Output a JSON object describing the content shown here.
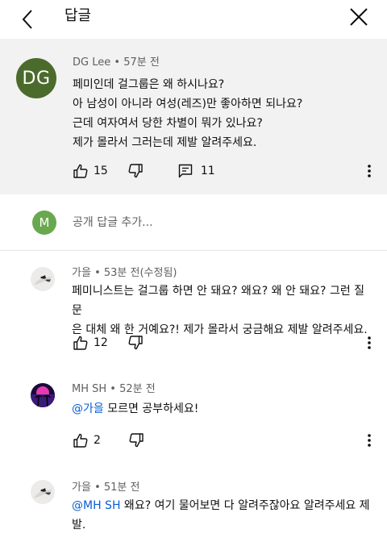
{
  "header": {
    "title": "답글"
  },
  "comment": {
    "avatar_initials": "DG",
    "author": "DG Lee",
    "time": "57분 전",
    "lines": [
      "페미인데 걸그룹은 왜 하시나요?",
      "아 남성이 아니라 여성(레즈)만 좋아하면 되나요?",
      "근데 여자여서 당한 차별이 뭐가 있나요?",
      "제가 몰라서 그러는데 제발 알려주세요."
    ],
    "likes": "15",
    "reply_count": "11"
  },
  "reply_input": {
    "avatar_initial": "M",
    "placeholder": "공개 답글 추가..."
  },
  "replies": [
    {
      "author": "가을",
      "time": "53분 전(수정됨)",
      "lines": [
        "페미니스트는 걸그룹 하면 안 돼요? 왜요? 왜 안 돼요? 그런 질문",
        "은 대체 왜 한 거예요?! 제가 몰라서 궁금해요 제발 알려주세요."
      ],
      "likes": "12"
    },
    {
      "author": "MH SH",
      "time": "52분 전",
      "mention": "@가을",
      "text": " 모르면 공부하세요!",
      "likes": "2"
    },
    {
      "author": "가을",
      "time": "51분 전",
      "mention": "@MH SH",
      "text": " 왜요? 여기 물어보면 다 알려주잖아요 알려주세요 제",
      "text2": "발."
    }
  ],
  "separator": "•"
}
